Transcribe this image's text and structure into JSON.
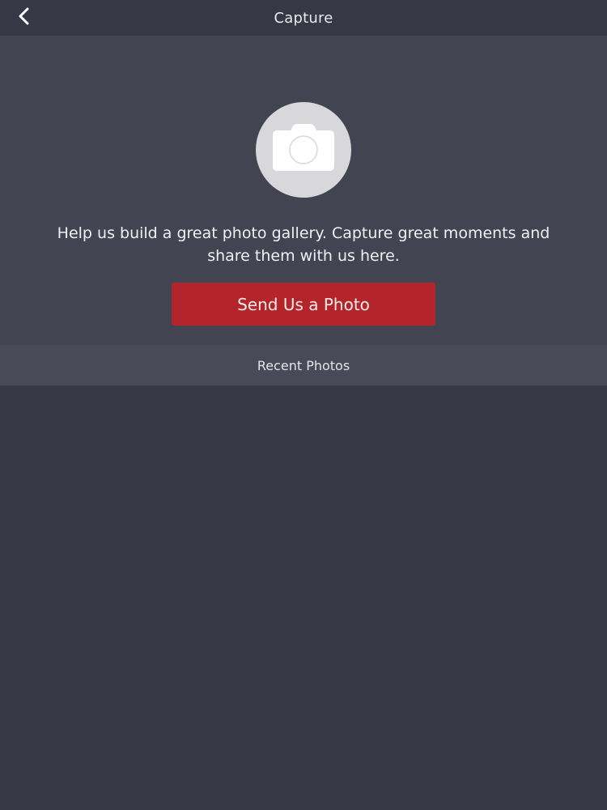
{
  "nav": {
    "title": "Capture",
    "back_icon": "chevron-left-icon"
  },
  "hero": {
    "icon": "camera-icon",
    "message": "Help us build a great photo gallery. Capture great moments and share them with us here.",
    "button_label": "Send Us a Photo"
  },
  "recent": {
    "header": "Recent Photos"
  },
  "colors": {
    "background": "#363845",
    "hero_background": "#434451",
    "section_header_background": "#484a57",
    "accent_button": "#b3252b",
    "camera_circle": "#d8d8da"
  }
}
